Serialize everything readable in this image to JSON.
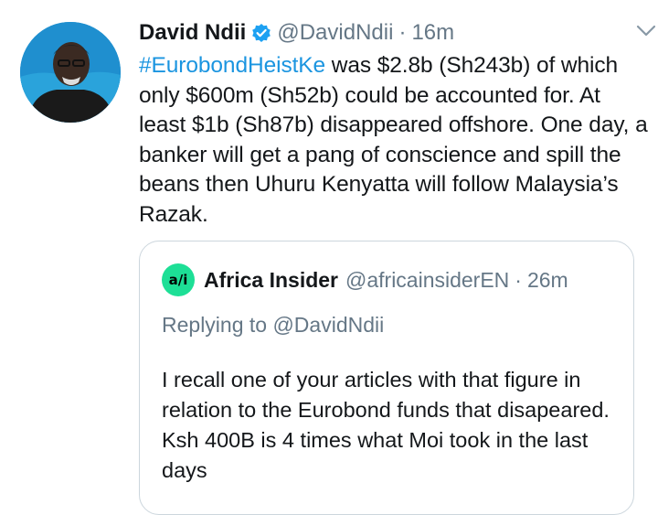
{
  "tweet": {
    "author_name": "David Ndii",
    "author_handle": "@DavidNdii",
    "separator": "·",
    "time": "16m",
    "hashtag": "#EurobondHeistKe",
    "text": " was $2.8b (Sh243b) of which only $600m (Sh52b) could be accounted for. At least $1b (Sh87b) disappeared offshore. One day, a banker will get a pang of conscience and spill the beans then Uhuru Kenyatta will follow Malaysia’s Razak."
  },
  "quote": {
    "avatar_glyph": "a/i",
    "author_name": "Africa Insider",
    "author_handle": "@africainsiderEN",
    "separator": "·",
    "time": "26m",
    "replying_to": "Replying to @DavidNdii",
    "text": "I recall one of your articles with that figure in relation to the Eurobond funds that disapeared. Ksh 400B is 4 times what Moi took in the last days"
  },
  "colors": {
    "link": "#1b95e0",
    "secondary_text": "#657786",
    "verified": "#1da1f2",
    "quote_avatar": "#1ddf96",
    "border": "#ccd6dd"
  },
  "icons": {
    "verified": "verified-badge-icon",
    "more": "chevron-down-icon"
  }
}
